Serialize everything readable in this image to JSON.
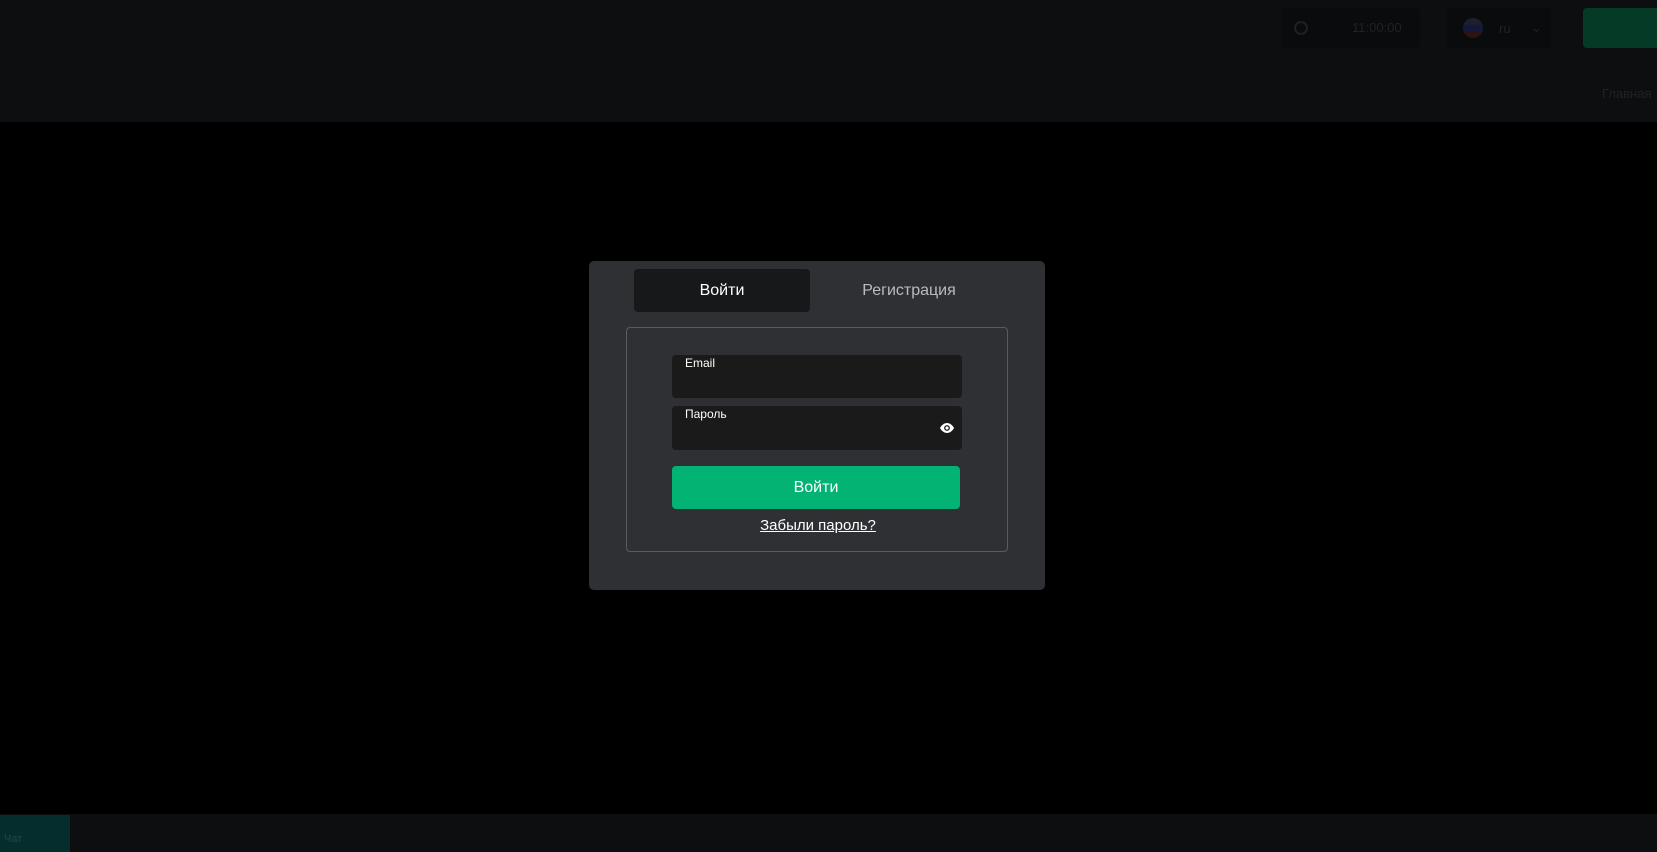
{
  "background": {
    "header_time": "11:00:00",
    "header_lang": "ru",
    "header_link": "Главная",
    "bottom_chip": "Чат"
  },
  "modal": {
    "tabs": [
      {
        "label": "Войти",
        "active": true
      },
      {
        "label": "Регистрация",
        "active": false
      }
    ],
    "email_field": {
      "label": "Email",
      "value": ""
    },
    "password_field": {
      "label": "Пароль",
      "value": ""
    },
    "submit_label": "Войти",
    "forgot_label": "Забыли пароль?"
  },
  "colors": {
    "accent": "#02b374",
    "modal_bg": "#2f3033",
    "field_bg": "#1a1a1b",
    "page_bg": "#000000"
  },
  "icons": {
    "password_toggle": "eye-icon",
    "clock": "clock-icon",
    "flag": "flag-icon",
    "chevron": "chevron-down-icon"
  }
}
